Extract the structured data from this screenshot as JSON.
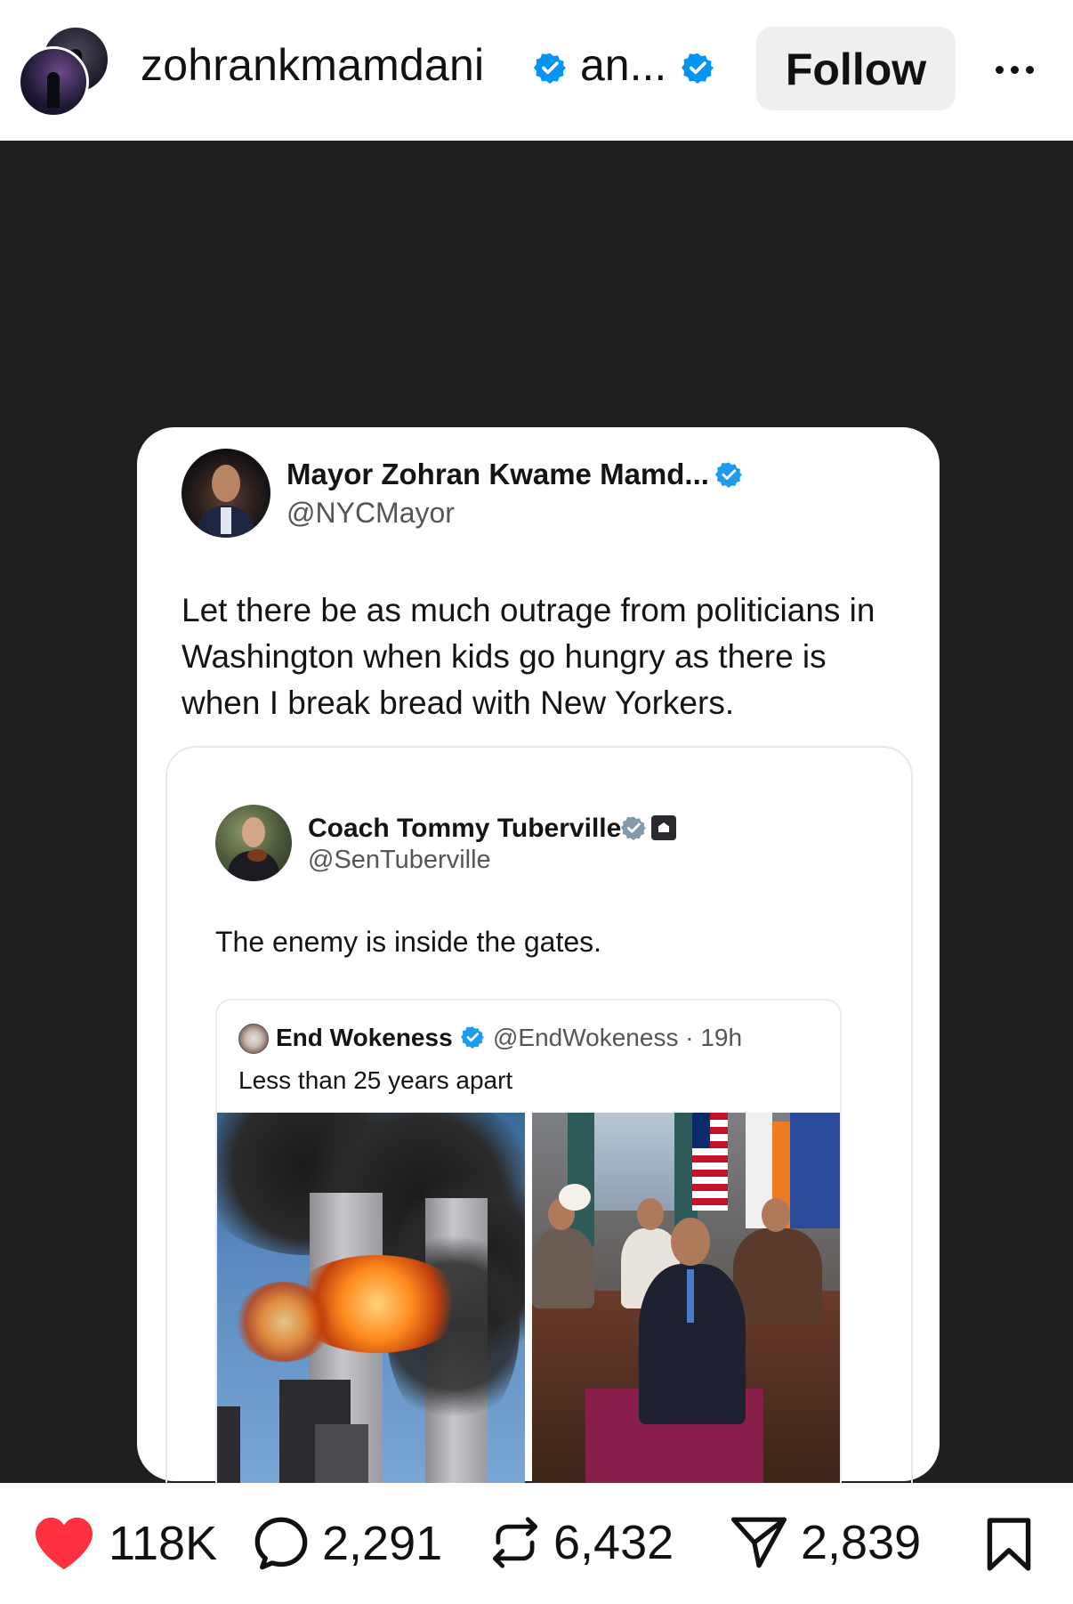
{
  "header": {
    "username": "zohrankmamdani",
    "collab_truncated": "an...",
    "follow_label": "Follow",
    "badge_color": "#0095f6"
  },
  "post": {
    "author_name": "Mayor Zohran Kwame Mamd...",
    "author_handle": "@NYCMayor",
    "text": "Let there be as much outrage from politicians in Washington when kids go hungry as there is when I break bread with New Yorkers.",
    "quoted": {
      "author_name": "Coach Tommy Tuberville",
      "author_handle": "@SenTuberville",
      "text": "The enemy is inside the gates.",
      "quoted": {
        "author_name": "End Wokeness",
        "meta": "@EndWokeness · 19h",
        "text": "Less than 25 years apart"
      }
    }
  },
  "actions": {
    "likes": "118K",
    "comments": "2,291",
    "reposts": "6,432",
    "shares": "2,839",
    "like_color": "#ff3040"
  }
}
